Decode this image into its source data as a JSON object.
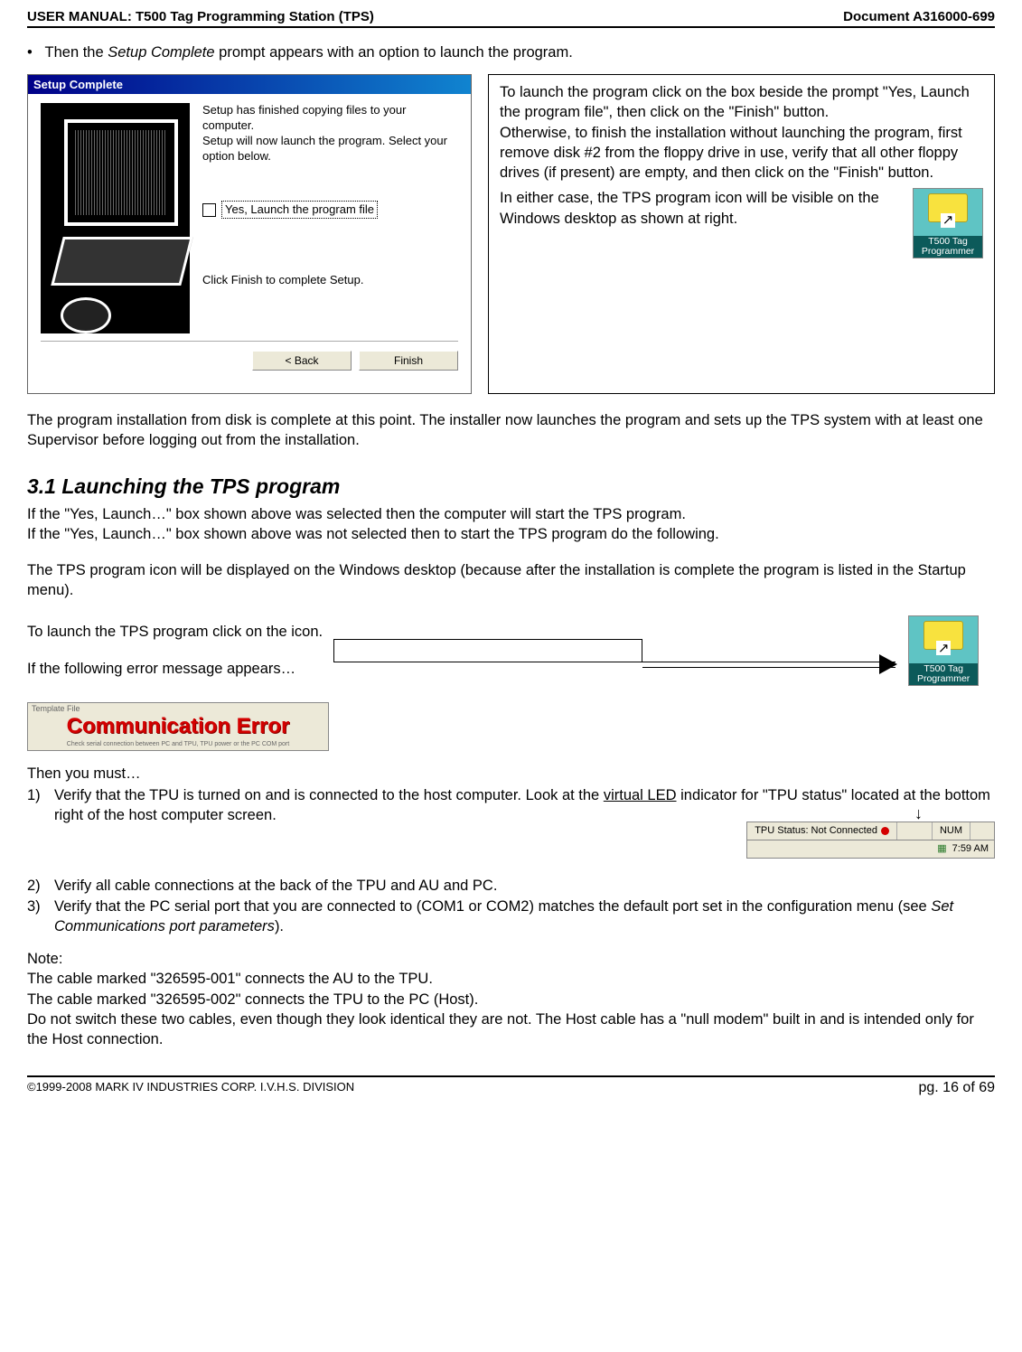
{
  "header": {
    "left": "USER MANUAL: T500 Tag Programming Station (TPS)",
    "right": "Document A316000-699"
  },
  "bullet1_prefix": "Then the ",
  "bullet1_italic": "Setup Complete",
  "bullet1_suffix": " prompt appears with an option to launch the program.",
  "dialog": {
    "title": "Setup Complete",
    "line1": "Setup has finished copying files to your computer.",
    "line2": "Setup will now launch the program. Select your option below.",
    "checkbox_label": "Yes, Launch the program file",
    "finish_hint": "Click Finish to complete Setup.",
    "back_btn": "< Back",
    "finish_btn": "Finish"
  },
  "info": {
    "p1": "To launch the program click on the box beside the prompt \"Yes, Launch the program file\", then click on the \"Finish\" button.",
    "p2": "Otherwise, to finish the installation without launching the program, first remove disk #2 from the floppy drive in use, verify that all other floppy drives (if present) are empty, and then click on the \"Finish\" button.",
    "p3": "In either case, the TPS program icon will be visible on the Windows desktop as shown at right.",
    "icon_label": "T500 Tag Programmer"
  },
  "para_after": "The program installation from disk is complete at this point. The installer now launches the program and sets up the TPS system with at least one Supervisor before logging out from the installation.",
  "section_title": "3.1 Launching the TPS program",
  "p_launch1": "If the \"Yes, Launch…\" box shown above was selected then the computer will start the TPS program.",
  "p_launch2": "If the \"Yes, Launch…\" box shown above was not selected then to start the TPS program do the following.",
  "p_launch3": "The TPS program icon will be displayed on the Windows desktop (because after the installation is complete the program is listed in the Startup menu).",
  "p_launch4": "To launch the TPS program click on the icon.",
  "p_launch5": "If the following error message appears…",
  "icon2_label": "T500 Tag Programmer",
  "comm_error": {
    "top": "Template File",
    "text": "Communication Error",
    "bottom": "Check serial connection between PC and TPU, TPU power or the PC COM port"
  },
  "then_you_must": "Then you must…",
  "item1_a": "Verify that the TPU is turned on and is connected to the host computer. Look at the ",
  "item1_vled": "virtual LED",
  "item1_b": " indicator for \"TPU status\" located at the bottom right of the host computer screen.",
  "status_bar": {
    "tpu": "TPU Status: Not Connected",
    "num": "NUM",
    "time": "7:59 AM"
  },
  "item2": "Verify all cable connections at the back of the TPU and AU and PC.",
  "item3_a": "Verify that the PC serial port that you are connected to (COM1 or COM2) matches the default port set in the configuration menu (see ",
  "item3_i": "Set Communications port parameters",
  "item3_b": ").",
  "note_label": "Note:",
  "note1": "The cable marked \"326595-001\" connects the AU to the TPU.",
  "note2": "The cable marked \"326595-002\" connects the TPU to the PC (Host).",
  "note3": "Do not switch these two cables, even though they look identical they are not. The Host cable has a \"null modem\" built in and is intended only for the Host connection.",
  "footer": {
    "left": "©1999-2008 MARK IV INDUSTRIES CORP. I.V.H.S. DIVISION",
    "right": "pg. 16 of 69"
  }
}
